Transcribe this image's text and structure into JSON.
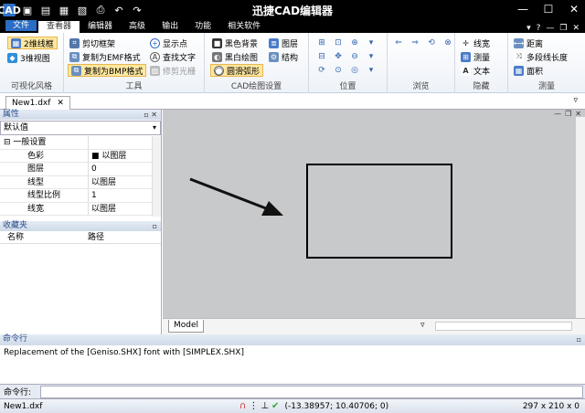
{
  "app": {
    "title": "迅捷CAD编辑器",
    "icon_text": "CAD"
  },
  "menu": {
    "tabs": [
      "文件",
      "查看器",
      "编辑器",
      "高级",
      "输出",
      "功能",
      "相关软件"
    ]
  },
  "ribbon": {
    "vis_style": {
      "label": "可视化风格",
      "btn_2d": "2维线框",
      "btn_3d": "3维视图"
    },
    "tools": {
      "label": "工具",
      "clip_frame": "剪切框架",
      "copy_emf": "复制为EMF格式",
      "copy_bmp": "复制为BMP格式",
      "show_points": "显示点",
      "find_text": "查找文字",
      "trim_raster": "修剪光栅"
    },
    "cad_settings": {
      "label": "CAD绘图设置",
      "black_bg": "黑色背景",
      "bw_draw": "黑白绘图",
      "smooth_arc": "圆滑弧形",
      "layers": "图层",
      "structure": "结构"
    },
    "position": {
      "label": "位置"
    },
    "browse": {
      "label": "浏览"
    },
    "hide": {
      "label": "隐藏",
      "linewidth": "线宽",
      "measure": "测量",
      "text": "文本"
    },
    "measure": {
      "label": "测量",
      "distance": "距离",
      "polyline_length": "多段线长度",
      "area": "面积"
    }
  },
  "doc": {
    "tab": "New1.dxf"
  },
  "properties": {
    "header": "属性",
    "filter": "默认值",
    "section": "一般设置",
    "rows": [
      {
        "k": "色彩",
        "v": "■ 以图层"
      },
      {
        "k": "图层",
        "v": "0"
      },
      {
        "k": "线型",
        "v": "以图层"
      },
      {
        "k": "线型比例",
        "v": "1"
      },
      {
        "k": "线宽",
        "v": "以图层"
      }
    ]
  },
  "favorites": {
    "header": "收藏夹",
    "col_name": "名称",
    "col_path": "路径"
  },
  "canvas": {
    "model_tab": "Model"
  },
  "command": {
    "header": "命令行",
    "output": "Replacement of the [Geniso.SHX] font with [SIMPLEX.SHX]",
    "prompt_label": "命令行:",
    "input_value": ""
  },
  "status": {
    "filename": "New1.dxf",
    "coords": "(-13.38957; 10.40706; 0)",
    "size": "297 x 210 x 0"
  },
  "colors": {
    "accent": "#2b6cc4",
    "canvas": "#c8c9cb"
  }
}
